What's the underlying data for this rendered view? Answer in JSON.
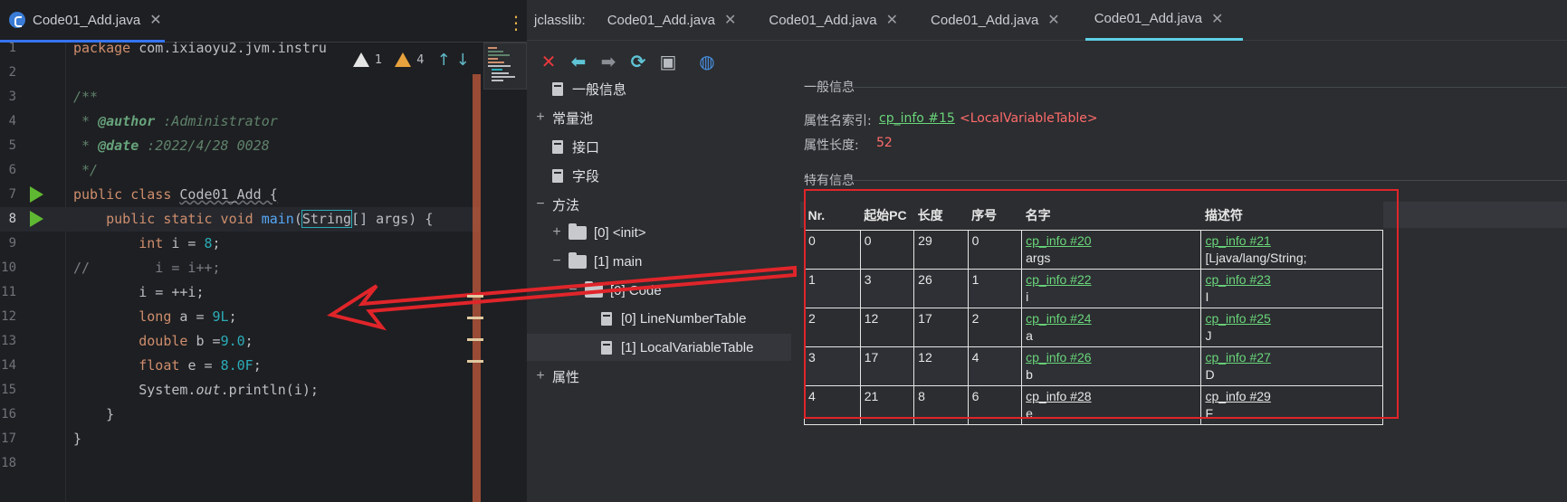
{
  "editor": {
    "tab_label": "Code01_Add.java",
    "warnings": {
      "errors": "1",
      "warnings": "4"
    },
    "lines": [
      {
        "n": "1",
        "parts": [
          [
            "kw",
            "package "
          ],
          [
            "cls",
            "com.ixiaoyu2.jvm.instru"
          ]
        ]
      },
      {
        "n": "2",
        "parts": []
      },
      {
        "n": "3",
        "parts": [
          [
            "doc",
            "/**"
          ]
        ]
      },
      {
        "n": "4",
        "parts": [
          [
            "doc",
            " * "
          ],
          [
            "tag",
            "@author"
          ],
          [
            "doc",
            " :Administrator"
          ]
        ]
      },
      {
        "n": "5",
        "parts": [
          [
            "doc",
            " * "
          ],
          [
            "tag",
            "@date"
          ],
          [
            "doc",
            " :2022/4/28 0028"
          ]
        ]
      },
      {
        "n": "6",
        "parts": [
          [
            "doc",
            " */"
          ]
        ]
      },
      {
        "n": "7",
        "parts": [
          [
            "kw",
            "public class "
          ],
          [
            "cls",
            "Code01_Add {"
          ]
        ]
      },
      {
        "n": "8",
        "parts": [
          [
            "kw",
            "    public static void "
          ],
          [
            "fn",
            "main"
          ],
          [
            "cls",
            "("
          ],
          [
            "cls",
            "String"
          ],
          [
            "cls",
            "[] "
          ],
          [
            "cls",
            "args) {"
          ]
        ]
      },
      {
        "n": "9",
        "parts": [
          [
            "kw",
            "        int "
          ],
          [
            "cls",
            "i = "
          ],
          [
            "num",
            "8"
          ],
          [
            "cls",
            ";"
          ]
        ]
      },
      {
        "n": "10",
        "parts": [
          [
            "cm",
            "//        i = i++;"
          ]
        ]
      },
      {
        "n": "11",
        "parts": [
          [
            "cls",
            "        i = ++i;"
          ]
        ]
      },
      {
        "n": "12",
        "parts": [
          [
            "kw",
            "        long "
          ],
          [
            "cls",
            "a = "
          ],
          [
            "num",
            "9L"
          ],
          [
            "cls",
            ";"
          ]
        ]
      },
      {
        "n": "13",
        "parts": [
          [
            "kw",
            "        double "
          ],
          [
            "cls",
            "b ="
          ],
          [
            "num",
            "9.0"
          ],
          [
            "cls",
            ";"
          ]
        ]
      },
      {
        "n": "14",
        "parts": [
          [
            "kw",
            "        float "
          ],
          [
            "cls",
            "e = "
          ],
          [
            "num",
            "8.0F"
          ],
          [
            "cls",
            ";"
          ]
        ]
      },
      {
        "n": "15",
        "parts": [
          [
            "cls",
            "        System."
          ],
          [
            "it",
            "out"
          ],
          [
            "cls",
            ".println(i);"
          ]
        ]
      },
      {
        "n": "16",
        "parts": [
          [
            "cls",
            "    }"
          ]
        ]
      },
      {
        "n": "17",
        "parts": [
          [
            "cls",
            "}"
          ]
        ]
      },
      {
        "n": "18",
        "parts": []
      }
    ]
  },
  "jclasslib": {
    "prefix": "jclasslib:",
    "tabs": [
      "Code01_Add.java",
      "Code01_Add.java",
      "Code01_Add.java",
      "Code01_Add.java"
    ],
    "active_tab": 3,
    "toolbar": [
      "close-icon",
      "back-icon",
      "forward-icon",
      "refresh-icon",
      "save-icon",
      "browser-icon"
    ],
    "tree": [
      {
        "label": "一般信息",
        "kind": "file",
        "expander": ""
      },
      {
        "label": "常量池",
        "kind": "folder-none",
        "expander": "+"
      },
      {
        "label": "接口",
        "kind": "file",
        "expander": ""
      },
      {
        "label": "字段",
        "kind": "file",
        "expander": ""
      },
      {
        "label": "方法",
        "kind": "folder-none",
        "expander": "−"
      },
      {
        "label": "[0] <init>",
        "kind": "folder",
        "expander": "+"
      },
      {
        "label": "[1] main",
        "kind": "folder",
        "expander": "−"
      },
      {
        "label": "[0] Code",
        "kind": "folder",
        "expander": "−"
      },
      {
        "label": "[0] LineNumberTable",
        "kind": "file",
        "expander": ""
      },
      {
        "label": "[1] LocalVariableTable",
        "kind": "file",
        "expander": ""
      },
      {
        "label": "属性",
        "kind": "folder-none",
        "expander": "+"
      }
    ],
    "detail": {
      "general_heading": "一般信息",
      "name_index_label": "属性名索引:",
      "name_index_link": "cp_info #15",
      "name_index_value": "<LocalVariableTable>",
      "length_label": "属性长度:",
      "length_value": "52",
      "specific_heading": "特有信息",
      "columns": [
        "Nr.",
        "起始PC",
        "长度",
        "序号",
        "名字",
        "描述符"
      ],
      "rows": [
        {
          "nr": "0",
          "start": "0",
          "len": "29",
          "idx": "0",
          "name_link": "cp_info #20",
          "name": "args",
          "desc_link": "cp_info #21",
          "desc": "[Ljava/lang/String;"
        },
        {
          "nr": "1",
          "start": "3",
          "len": "26",
          "idx": "1",
          "name_link": "cp_info #22",
          "name": "i",
          "desc_link": "cp_info #23",
          "desc": "I"
        },
        {
          "nr": "2",
          "start": "12",
          "len": "17",
          "idx": "2",
          "name_link": "cp_info #24",
          "name": "a",
          "desc_link": "cp_info #25",
          "desc": "J"
        },
        {
          "nr": "3",
          "start": "17",
          "len": "12",
          "idx": "4",
          "name_link": "cp_info #26",
          "name": "b",
          "desc_link": "cp_info #27",
          "desc": "D"
        },
        {
          "nr": "4",
          "start": "21",
          "len": "8",
          "idx": "6",
          "name_link": "cp_info #28",
          "name": "e",
          "desc_link": "cp_info #29",
          "desc": "F"
        }
      ]
    }
  },
  "colors": {
    "highlight_box": "#e0252a",
    "accent_tab": "#5fd0e6",
    "link": "#6ad57a"
  }
}
